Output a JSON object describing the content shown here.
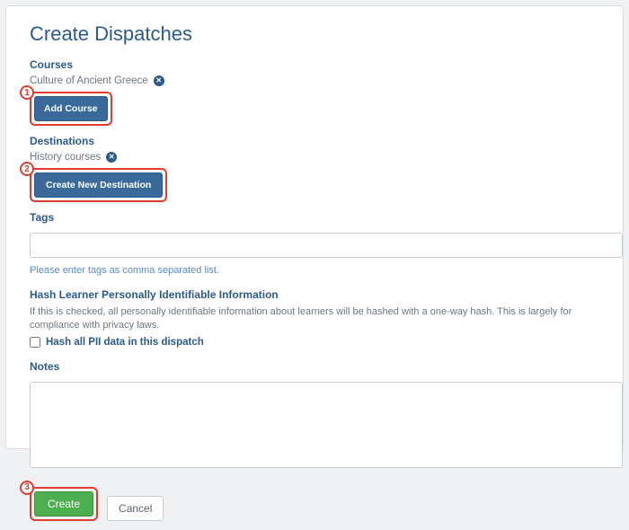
{
  "page": {
    "title": "Create Dispatches"
  },
  "courses": {
    "label": "Courses",
    "items": [
      {
        "name": "Culture of Ancient Greece"
      }
    ],
    "add_button": "Add Course"
  },
  "destinations": {
    "label": "Destinations",
    "items": [
      {
        "name": "History courses"
      }
    ],
    "create_button": "Create New Destination"
  },
  "tags": {
    "label": "Tags",
    "value": "",
    "hint": "Please enter tags as comma separated list."
  },
  "hash": {
    "heading": "Hash Learner Personally Identifiable Information",
    "description": "If this is checked, all personally identifiable information about learners will be hashed with a one-way hash. This is largely for compliance with privacy laws.",
    "checkbox_label": "Hash all PII data in this dispatch",
    "checked": false
  },
  "notes": {
    "label": "Notes",
    "value": ""
  },
  "footer": {
    "create": "Create",
    "cancel": "Cancel"
  },
  "annotations": {
    "a1": "1",
    "a2": "2",
    "a3": "3"
  }
}
